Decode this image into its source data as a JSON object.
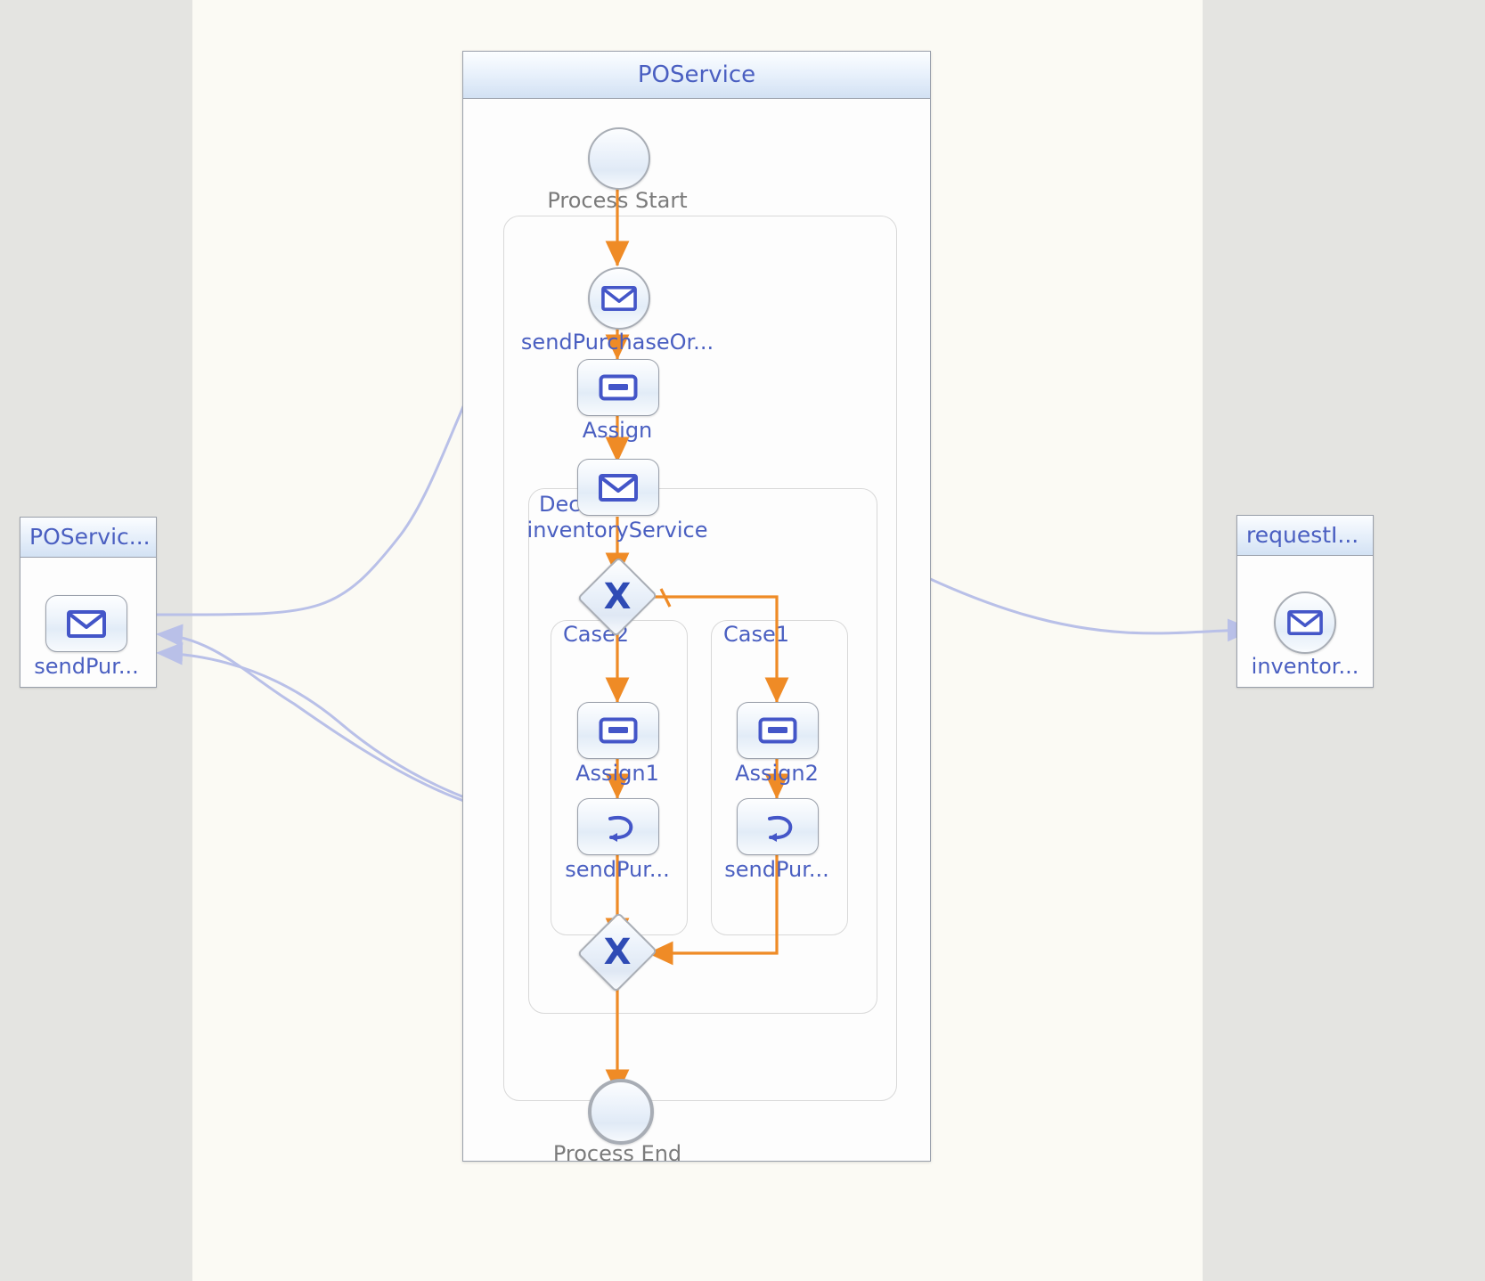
{
  "diagram": {
    "type": "bpel-process",
    "title": "POService"
  },
  "colors": {
    "flow_arrow": "#ef8b26",
    "message_link": "#b9c0e8",
    "label_blue": "#4a5fc1",
    "label_grey": "#7b7b7b",
    "panel_border": "#9aa0ab",
    "background_left": "#e4e4e1",
    "background_center": "#fbfaf4",
    "background_right": "#e4e4e1"
  },
  "main_container": {
    "title": "POService",
    "nodes": {
      "process_start": {
        "label": "Process Start",
        "icon": "start-event-circle-icon"
      },
      "receive": {
        "label": "sendPurchaseOr...",
        "icon": "envelope-icon"
      },
      "assign": {
        "label": "Assign",
        "icon": "assign-box-icon"
      },
      "invoke": {
        "label": "inventoryService",
        "icon": "envelope-icon"
      },
      "decision_gateway": {
        "label": "X",
        "icon": "exclusive-gateway-icon"
      },
      "merge_gateway": {
        "label": "X",
        "icon": "exclusive-gateway-icon"
      },
      "process_end": {
        "label": "Process End",
        "icon": "end-event-circle-icon"
      }
    },
    "scopes": {
      "sequence": {
        "label": ""
      },
      "decision": {
        "label": "Decision"
      },
      "case2": {
        "label": "Case2",
        "nodes": [
          {
            "label": "Assign1",
            "icon": "assign-box-icon"
          },
          {
            "label": "sendPur...",
            "icon": "reply-arrow-icon"
          }
        ]
      },
      "case1": {
        "label": "Case1",
        "nodes": [
          {
            "label": "Assign2",
            "icon": "assign-box-icon"
          },
          {
            "label": "sendPur...",
            "icon": "reply-arrow-icon"
          }
        ]
      }
    }
  },
  "partner_left": {
    "title": "POServic...",
    "node": {
      "label": "sendPur...",
      "icon": "envelope-icon"
    }
  },
  "partner_right": {
    "title": "requestI...",
    "node": {
      "label": "inventor...",
      "icon": "envelope-icon"
    }
  }
}
